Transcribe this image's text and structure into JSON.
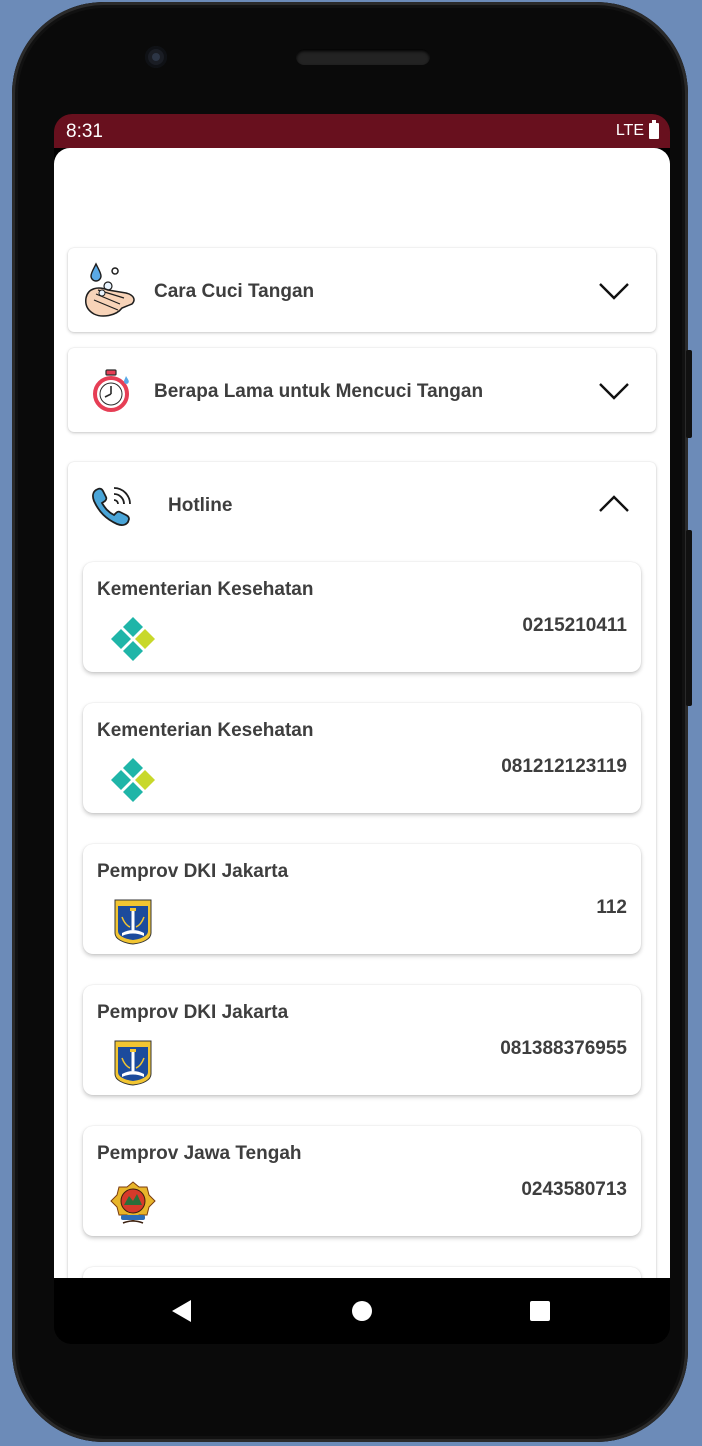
{
  "status_bar": {
    "time": "8:31",
    "network": "LTE"
  },
  "sections": [
    {
      "title": "Cara Cuci Tangan",
      "icon": "hand-washing-icon",
      "expanded": false
    },
    {
      "title": "Berapa Lama untuk Mencuci Tangan",
      "icon": "stopwatch-icon",
      "expanded": false
    },
    {
      "title": "Hotline",
      "icon": "phone-icon",
      "expanded": true
    }
  ],
  "hotlines": [
    {
      "name": "Kementerian Kesehatan",
      "phone": "0215210411",
      "logo": "kemenkes-logo-icon"
    },
    {
      "name": "Kementerian Kesehatan",
      "phone": "081212123119",
      "logo": "kemenkes-logo-icon"
    },
    {
      "name": "Pemprov DKI Jakarta",
      "phone": "112",
      "logo": "dki-jakarta-emblem-icon"
    },
    {
      "name": "Pemprov DKI Jakarta",
      "phone": "081388376955",
      "logo": "dki-jakarta-emblem-icon"
    },
    {
      "name": "Pemprov Jawa Tengah",
      "phone": "0243580713",
      "logo": "jawa-tengah-emblem-icon"
    }
  ],
  "colors": {
    "status_bar": "#68101e",
    "text": "#3e3e3e",
    "kemenkes_teal": "#1fb5a8",
    "kemenkes_lime": "#c8d82a"
  }
}
